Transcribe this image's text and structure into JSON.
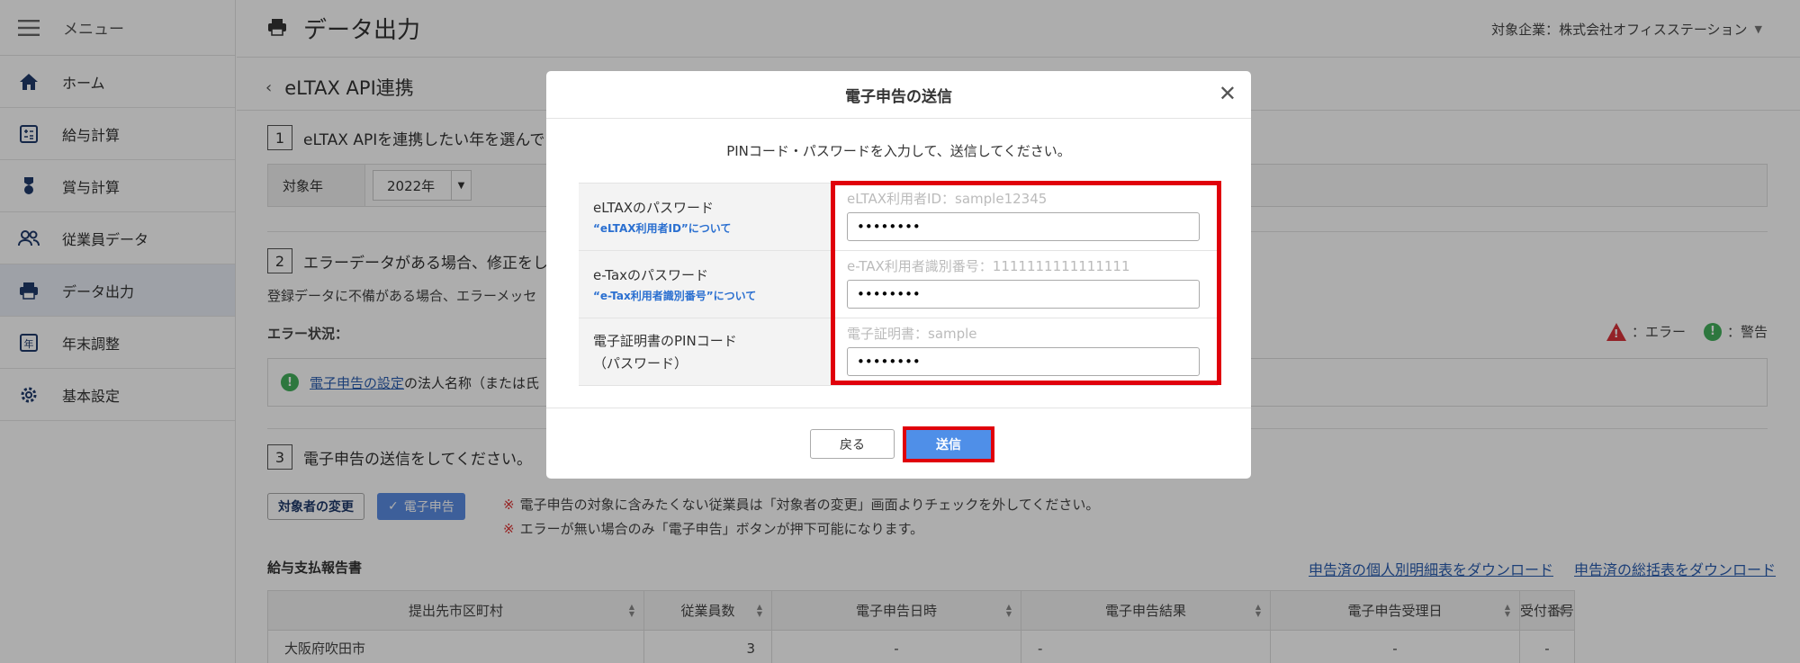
{
  "sidebar": {
    "menu_label": "メニュー",
    "items": [
      {
        "label": "ホーム"
      },
      {
        "label": "給与計算"
      },
      {
        "label": "賞与計算"
      },
      {
        "label": "従業員データ"
      },
      {
        "label": "データ出力"
      },
      {
        "label": "年末調整"
      },
      {
        "label": "基本設定"
      }
    ]
  },
  "header": {
    "title": "データ出力",
    "company": "対象企業：株式会社オフィスステーション"
  },
  "main": {
    "breadcrumb": "eLTAX API連携",
    "step1": {
      "num": "1",
      "text": "eLTAX APIを連携したい年を選んでく"
    },
    "year_label": "対象年",
    "year_value": "2022年",
    "step2": {
      "num": "2",
      "text": "エラーデータがある場合、修正をし"
    },
    "step2_desc": "登録データに不備がある場合、エラーメッセ",
    "error_status_label": "エラー状況：",
    "legend_error": "：エラー",
    "legend_warning": "：警告",
    "error_link": "電子申告の設定",
    "error_text": "の法人名称（または氏",
    "step3": {
      "num": "3",
      "text": "電子申告の送信をしてください。"
    },
    "change_button": "対象者の変更",
    "efile_button": "電子申告",
    "note_mark": "※",
    "note1": "電子申告の対象に含みたくない従業員は「対象者の変更」画面よりチェックを外してください。",
    "note2": "エラーが無い場合のみ「電子申告」ボタンが押下可能になります。",
    "report_title": "給与支払報告書",
    "download_individual": "申告済の個人別明細表をダウンロード",
    "download_summary": "申告済の総括表をダウンロード",
    "table": {
      "headers": [
        "提出先市区町村",
        "従業員数",
        "電子申告日時",
        "電子申告結果",
        "電子申告受理日",
        "受付番号"
      ],
      "rows": [
        [
          "大阪府吹田市",
          "3",
          "-",
          "-",
          "-",
          "-"
        ]
      ]
    }
  },
  "modal": {
    "title": "電子申告の送信",
    "intro": "PINコード・パスワードを入力して、送信してください。",
    "fields": [
      {
        "label": "eLTAXのパスワード",
        "sublabel": "“eLTAX利用者ID”について",
        "hint": "eLTAX利用者ID：sample12345",
        "value": "••••••••"
      },
      {
        "label": "e-Taxのパスワード",
        "sublabel": "“e-Tax利用者識別番号”について",
        "hint": "e-TAX利用者識別番号：1111111111111111",
        "value": "••••••••"
      },
      {
        "label": "電子証明書のPINコード",
        "label2": "（パスワード）",
        "hint": "電子証明書：sample",
        "value": "••••••••"
      }
    ],
    "back_button": "戻る",
    "send_button": "送信"
  },
  "colors": {
    "highlight": "#e0000b",
    "primary": "#4f8fe8",
    "link": "#2a5db0",
    "error": "#d9333a",
    "warning": "#43b05c"
  }
}
